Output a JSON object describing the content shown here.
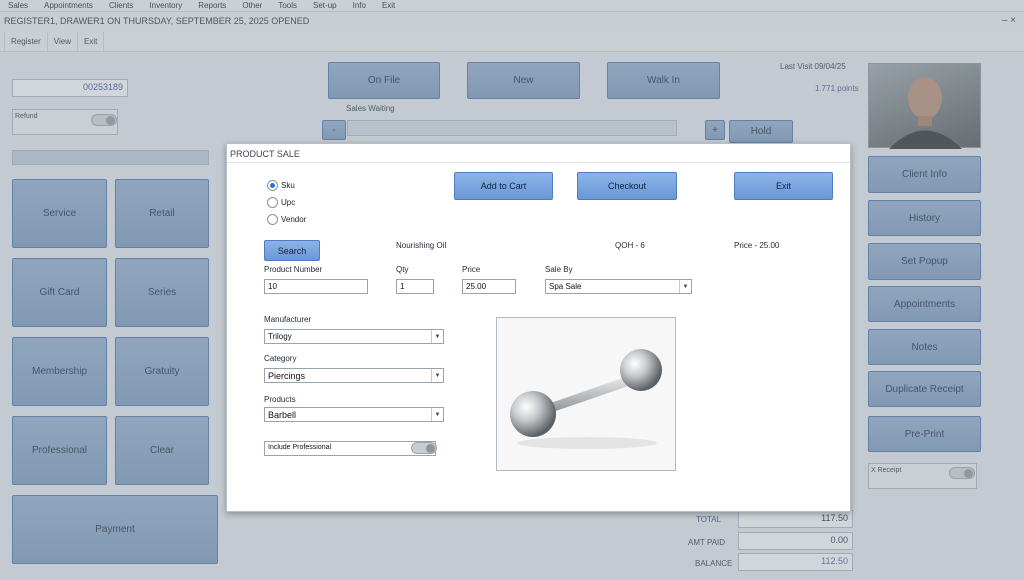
{
  "menubar": [
    "Sales",
    "Appointments",
    "Clients",
    "Inventory",
    "Reports",
    "Other",
    "Tools",
    "Set-up",
    "Info",
    "Exit"
  ],
  "title": "REGISTER1, DRAWER1 ON THURSDAY, SEPTEMBER 25, 2025 OPENED",
  "window_controls": "– ×",
  "subbar": [
    "Register",
    "View",
    "Exit"
  ],
  "left": {
    "ticket_number": "00253189",
    "refund_label": "Refund",
    "buttons": [
      "Service",
      "Retail",
      "Gift Card",
      "Series",
      "Membership",
      "Gratuity",
      "Professional",
      "Clear"
    ],
    "payment": "Payment"
  },
  "top": {
    "on_file": "On File",
    "new": "New",
    "walk_in": "Walk In",
    "sales_waiting": "Sales Waiting",
    "minus": "-",
    "plus": "+",
    "hold": "Hold"
  },
  "client": {
    "last_visit": "Last Visit 09/04/25",
    "points": "1.771 points"
  },
  "right_buttons": [
    "Client Info",
    "History",
    "Set Popup",
    "Appointments",
    "Notes",
    "Duplicate Receipt",
    "Pre-Print"
  ],
  "x_receipt": "X Receipt",
  "totals": {
    "total_label": "TOTAL",
    "total_value": "117.50",
    "amt_paid_label": "AMT PAID",
    "amt_paid_value": "0.00",
    "balance_label": "BALANCE",
    "balance_value": "112.50"
  },
  "modal": {
    "title": "PRODUCT SALE",
    "radios": [
      "Sku",
      "Upc",
      "Vendor"
    ],
    "add_to_cart": "Add to Cart",
    "checkout": "Checkout",
    "exit": "Exit",
    "search": "Search",
    "product_name": "Nourishing Oil",
    "qoh": "QOH - 6",
    "price_text": "Price - 25.00",
    "product_number_label": "Product Number",
    "product_number": "10",
    "qty_label": "Qty",
    "qty": "1",
    "price_label": "Price",
    "price": "25.00",
    "sale_by_label": "Sale By",
    "sale_by": "Spa Sale",
    "manufacturer_label": "Manufacturer",
    "manufacturer": "Trilogy",
    "category_label": "Category",
    "category": "Piercings",
    "products_label": "Products",
    "products": "Barbell",
    "include_professional": "Include Professional"
  }
}
